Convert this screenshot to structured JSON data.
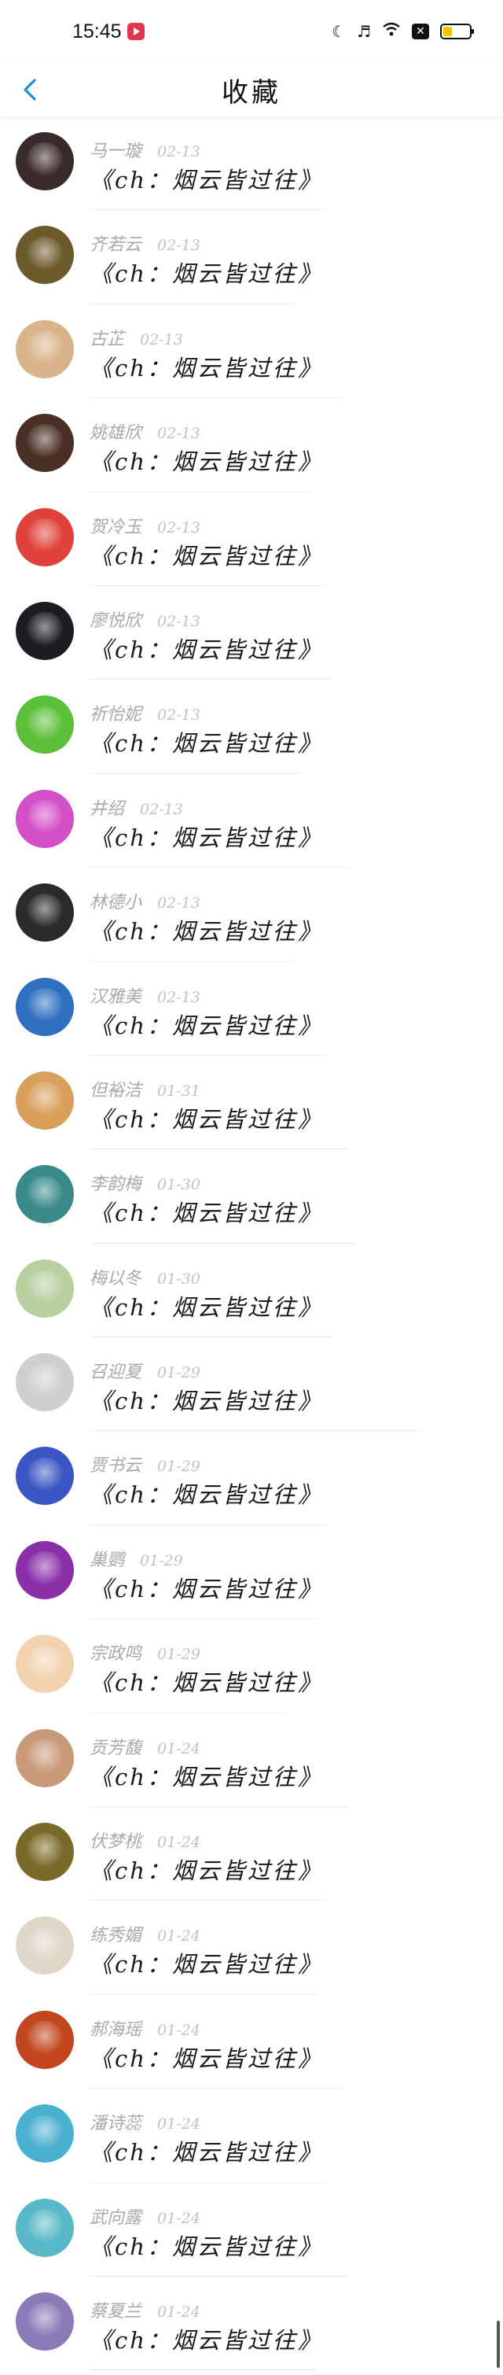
{
  "status_bar": {
    "time": "15:45",
    "icons": [
      "app-notification-icon",
      "moon-icon",
      "mute-icon",
      "wifi-icon",
      "close-box-icon",
      "battery-icon"
    ]
  },
  "nav": {
    "back_icon": "chevron-left-icon",
    "title": "收藏"
  },
  "items": [
    {
      "name": "马一璇",
      "date": "02-13",
      "message": "《ch：烟云皆过往》",
      "avatar_color": "#3a2b2b"
    },
    {
      "name": "齐若云",
      "date": "02-13",
      "message": "《ch：烟云皆过往》",
      "avatar_color": "#6b5a2a"
    },
    {
      "name": "古芷",
      "date": "02-13",
      "message": "《ch：烟云皆过往》",
      "avatar_color": "#d9b48a"
    },
    {
      "name": "姚雄欣",
      "date": "02-13",
      "message": "《ch：烟云皆过往》",
      "avatar_color": "#4a2f24"
    },
    {
      "name": "贺冷玉",
      "date": "02-13",
      "message": "《ch：烟云皆过往》",
      "avatar_color": "#e0413a"
    },
    {
      "name": "廖悦欣",
      "date": "02-13",
      "message": "《ch：烟云皆过往》",
      "avatar_color": "#1c1c22"
    },
    {
      "name": "祈怡妮",
      "date": "02-13",
      "message": "《ch：烟云皆过往》",
      "avatar_color": "#5cbf3a"
    },
    {
      "name": "井绍",
      "date": "02-13",
      "message": "《ch：烟云皆过往》",
      "avatar_color": "#d24fc8"
    },
    {
      "name": "林德小",
      "date": "02-13",
      "message": "《ch：烟云皆过往》",
      "avatar_color": "#2a2a2a"
    },
    {
      "name": "汉雅美",
      "date": "02-13",
      "message": "《ch：烟云皆过往》",
      "avatar_color": "#2f6fc0"
    },
    {
      "name": "但裕洁",
      "date": "01-31",
      "message": "《ch：烟云皆过往》",
      "avatar_color": "#d8a05a"
    },
    {
      "name": "李韵梅",
      "date": "01-30",
      "message": "《ch：烟云皆过往》",
      "avatar_color": "#3a8a8a"
    },
    {
      "name": "梅以冬",
      "date": "01-30",
      "message": "《ch：烟云皆过往》",
      "avatar_color": "#b8cfa0"
    },
    {
      "name": "召迎夏",
      "date": "01-29",
      "message": "《ch：烟云皆过往》",
      "avatar_color": "#cfcfcf"
    },
    {
      "name": "贾书云",
      "date": "01-29",
      "message": "《ch：烟云皆过往》",
      "avatar_color": "#3b55c4"
    },
    {
      "name": "巢鹦",
      "date": "01-29",
      "message": "《ch：烟云皆过往》",
      "avatar_color": "#8a2fa8"
    },
    {
      "name": "宗政鸣",
      "date": "01-29",
      "message": "《ch：烟云皆过往》",
      "avatar_color": "#f2d3b0"
    },
    {
      "name": "贡芳馥",
      "date": "01-24",
      "message": "《ch：烟云皆过往》",
      "avatar_color": "#c99a7a"
    },
    {
      "name": "伏梦桃",
      "date": "01-24",
      "message": "《ch：烟云皆过往》",
      "avatar_color": "#7a6a2a"
    },
    {
      "name": "练秀媚",
      "date": "01-24",
      "message": "《ch：烟云皆过往》",
      "avatar_color": "#e0d6c8"
    },
    {
      "name": "郝海瑶",
      "date": "01-24",
      "message": "《ch：烟云皆过往》",
      "avatar_color": "#c2461e"
    },
    {
      "name": "潘诗蕊",
      "date": "01-24",
      "message": "《ch：烟云皆过往》",
      "avatar_color": "#4ab0d0"
    },
    {
      "name": "武向露",
      "date": "01-24",
      "message": "《ch：烟云皆过往》",
      "avatar_color": "#58b8c8"
    },
    {
      "name": "蔡夏兰",
      "date": "01-24",
      "message": "《ch：烟云皆过往》",
      "avatar_color": "#8a7ab8"
    }
  ]
}
